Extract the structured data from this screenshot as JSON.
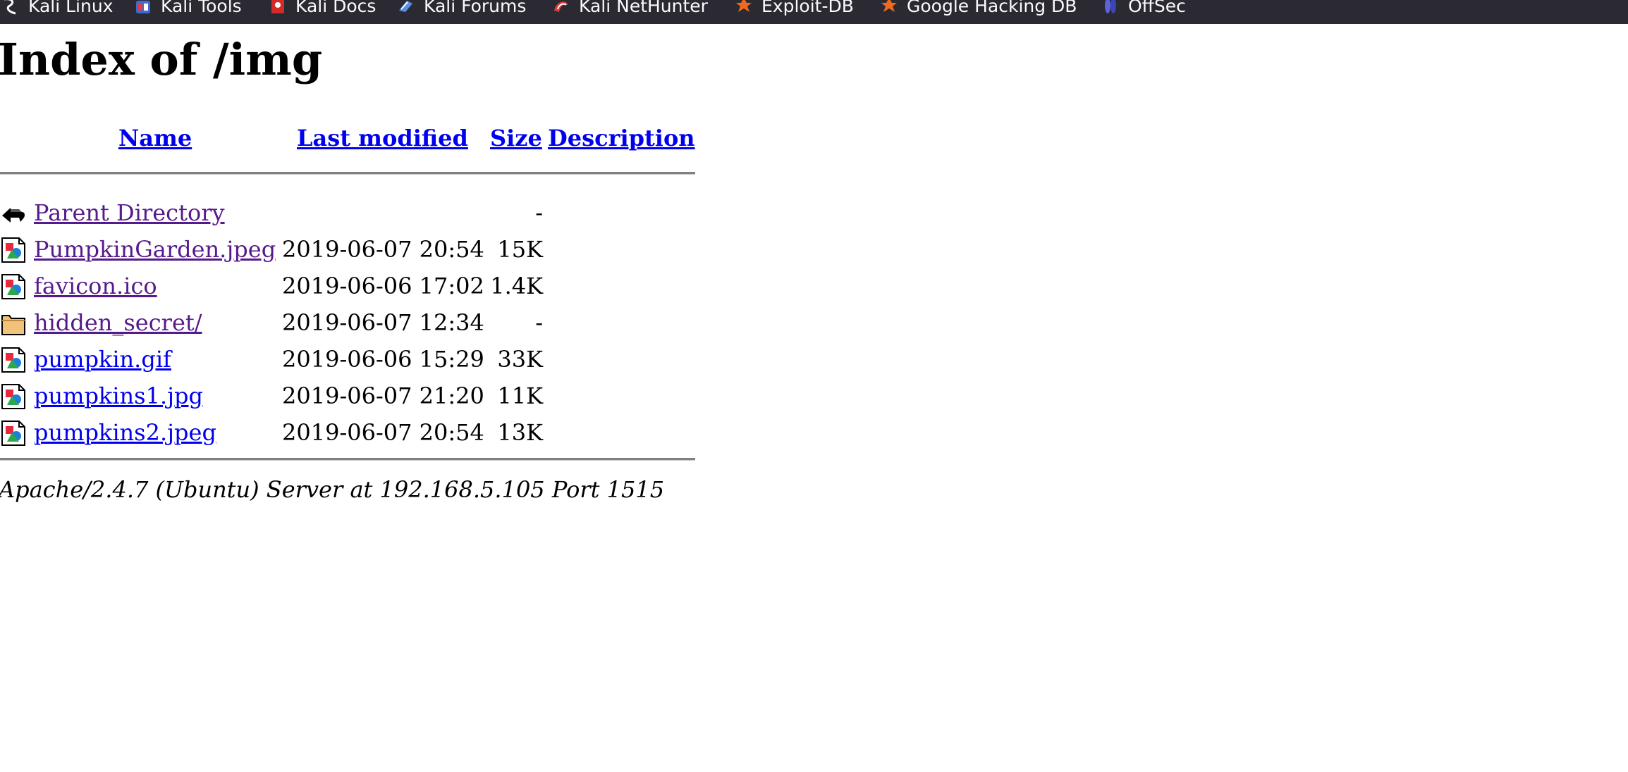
{
  "bookmarks": [
    {
      "label": "Kali Linux",
      "icon": "kali-dragon-icon"
    },
    {
      "label": "Kali Tools",
      "icon": "kali-tools-icon"
    },
    {
      "label": "Kali Docs",
      "icon": "kali-docs-icon"
    },
    {
      "label": "Kali Forums",
      "icon": "kali-forums-icon"
    },
    {
      "label": "Kali NetHunter",
      "icon": "kali-nethunter-icon"
    },
    {
      "label": "Exploit-DB",
      "icon": "exploit-db-icon"
    },
    {
      "label": "Google Hacking DB",
      "icon": "ghdb-icon"
    },
    {
      "label": "OffSec",
      "icon": "offsec-icon"
    }
  ],
  "page": {
    "title": "Index of /img",
    "columns": {
      "name": "Name",
      "last_modified": "Last modified",
      "size": "Size",
      "description": "Description"
    },
    "rows": [
      {
        "name": "Parent Directory",
        "modified": "",
        "size": "-",
        "icon": "back-arrow-icon",
        "visited": true
      },
      {
        "name": "PumpkinGarden.jpeg",
        "modified": "2019-06-07 20:54",
        "size": "15K",
        "icon": "image-file-icon",
        "visited": true
      },
      {
        "name": "favicon.ico",
        "modified": "2019-06-06 17:02",
        "size": "1.4K",
        "icon": "image-file-icon",
        "visited": true
      },
      {
        "name": "hidden_secret/",
        "modified": "2019-06-07 12:34",
        "size": "-",
        "icon": "folder-icon",
        "visited": true
      },
      {
        "name": "pumpkin.gif",
        "modified": "2019-06-06 15:29",
        "size": "33K",
        "icon": "image-file-icon",
        "visited": false
      },
      {
        "name": "pumpkins1.jpg",
        "modified": "2019-06-07 21:20",
        "size": "11K",
        "icon": "image-file-icon",
        "visited": false
      },
      {
        "name": "pumpkins2.jpeg",
        "modified": "2019-06-07 20:54",
        "size": "13K",
        "icon": "image-file-icon",
        "visited": false
      }
    ],
    "footer": "Apache/2.4.7 (Ubuntu) Server at 192.168.5.105 Port 1515"
  },
  "colors": {
    "link": "#0000ee",
    "visited_link": "#551a8b",
    "toolbar_bg": "#2b2a33",
    "toolbar_text": "#fbfbfe"
  }
}
